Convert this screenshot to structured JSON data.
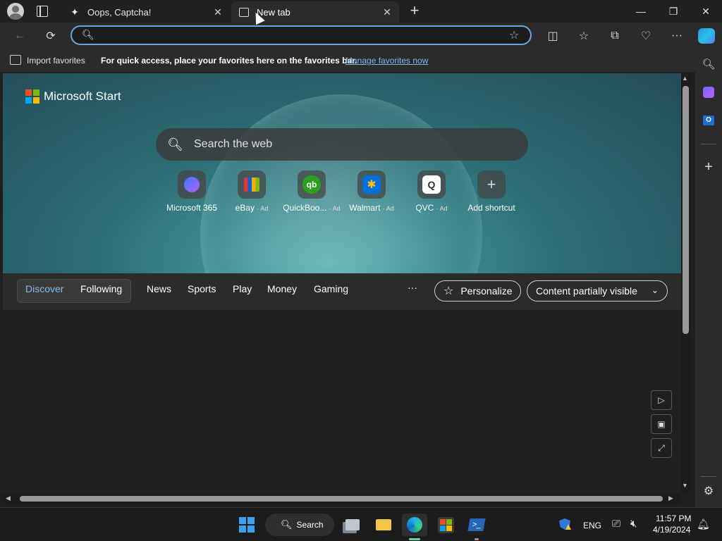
{
  "browser": {
    "tabs": [
      {
        "label": "Oops, Captcha!",
        "icon": "sparkle-icon"
      },
      {
        "label": "New tab",
        "icon": "newtab-icon",
        "active": true
      }
    ],
    "address": {
      "value": "",
      "placeholder": ""
    },
    "favorites_bar": {
      "import_label": "Import favorites",
      "message": "For quick access, place your favorites here on the favorites bar.",
      "manage_link": "Manage favorites now"
    }
  },
  "page": {
    "brand": "Microsoft Start",
    "search_placeholder": "Search the web",
    "shortcuts": [
      {
        "label": "Microsoft 365",
        "ad": ""
      },
      {
        "label": "eBay",
        "ad": "· Ad"
      },
      {
        "label": "QuickBoo...",
        "ad": "· Ad"
      },
      {
        "label": "Walmart",
        "ad": "· Ad"
      },
      {
        "label": "QVC",
        "ad": "· Ad"
      },
      {
        "label": "Add shortcut",
        "ad": ""
      }
    ],
    "feed_nav": {
      "discover": "Discover",
      "following": "Following",
      "items": [
        "News",
        "Sports",
        "Play",
        "Money",
        "Gaming"
      ],
      "more": "···",
      "personalize": "Personalize",
      "content_visibility": "Content partially visible"
    }
  },
  "taskbar": {
    "search_label": "Search",
    "language": "ENG",
    "time": "11:57 PM",
    "date": "4/19/2024"
  },
  "colors": {
    "accent": "#6aa7e0",
    "discover_active": "#7fb8f0",
    "link": "#7fb8f0"
  }
}
